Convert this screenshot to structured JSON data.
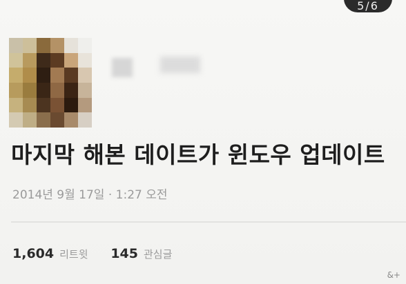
{
  "page_indicator": "5/6",
  "tweet": {
    "text": "마지막 해본 데이트가 윈도우 업데이트",
    "timestamp": "2014년 9월 17일 · 1:27 오전"
  },
  "stats": {
    "retweets_count": "1,604",
    "retweets_label": "리트윗",
    "favorites_count": "145",
    "favorites_label": "관심글"
  },
  "watermark": "&+",
  "colors": {
    "background": "#f7f7f5",
    "text": "#1e1e1e",
    "muted": "#9a9a9a"
  }
}
